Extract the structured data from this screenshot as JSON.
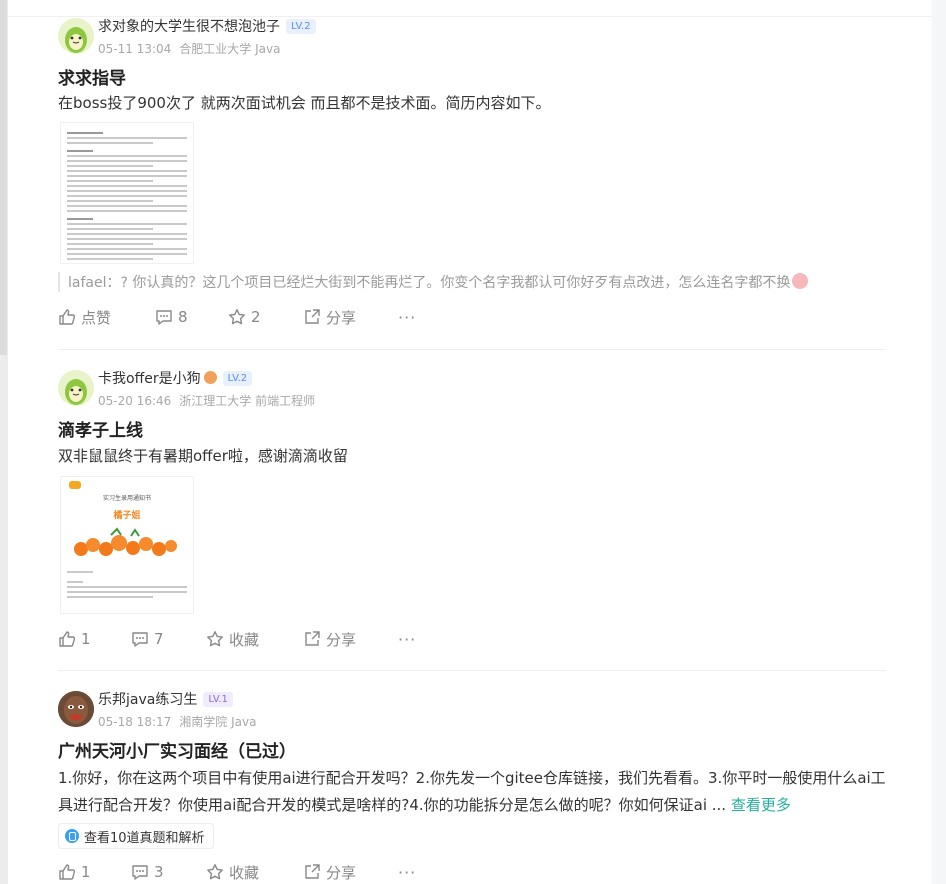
{
  "posts": [
    {
      "username": "求对象的大学生很不想泡池子",
      "level": "LV.2",
      "date": "05-11 13:04",
      "school": "合肥工业大学 Java",
      "title": "求求指导",
      "content": "在boss投了900次了 就两次面试机会 而且都不是技术面。简历内容如下。",
      "comment_user": "lafael：",
      "comment_text": "? 你认真的？这几个项目已经烂大街到不能再烂了。你变个名字我都认可你好歹有点改进，怎么连名字都不换",
      "actions": {
        "like": "点赞",
        "comments": "8",
        "favorites": "2",
        "share": "分享",
        "more": "···"
      }
    },
    {
      "username": "卡我offer是小狗",
      "level": "LV.2",
      "date": "05-20 16:46",
      "school": "浙江理工大学 前端工程师",
      "title": "滴孝子上线",
      "content": "双非鼠鼠终于有暑期offer啦，感谢滴滴收留",
      "thumb_heading": "实习生录用通知书",
      "thumb_subtitle": "橘子姐",
      "actions": {
        "like": "1",
        "comments": "7",
        "favorites": "收藏",
        "share": "分享",
        "more": "···"
      }
    },
    {
      "username": "乐邦java练习生",
      "level": "LV.1",
      "date": "05-18 18:17",
      "school": "湘南学院 Java",
      "title": "广州天河小厂实习面经（已过）",
      "content": "1.你好，你在这两个项目中有使用ai进行配合开发吗？2.你先发一个gitee仓库链接，我们先看看。3.你平时一般使用什么ai工具进行配合开发？你使用ai配合开发的模式是啥样的?4.你的功能拆分是怎么做的呢？你如何保证ai ...",
      "see_more": "查看更多",
      "chip": "查看10道真题和解析",
      "actions": {
        "like": "1",
        "comments": "3",
        "favorites": "收藏",
        "share": "分享",
        "more": "···"
      }
    }
  ],
  "colors": {
    "accent": "#21b29f",
    "meta": "#a8a8a8",
    "icon": "#888888"
  }
}
